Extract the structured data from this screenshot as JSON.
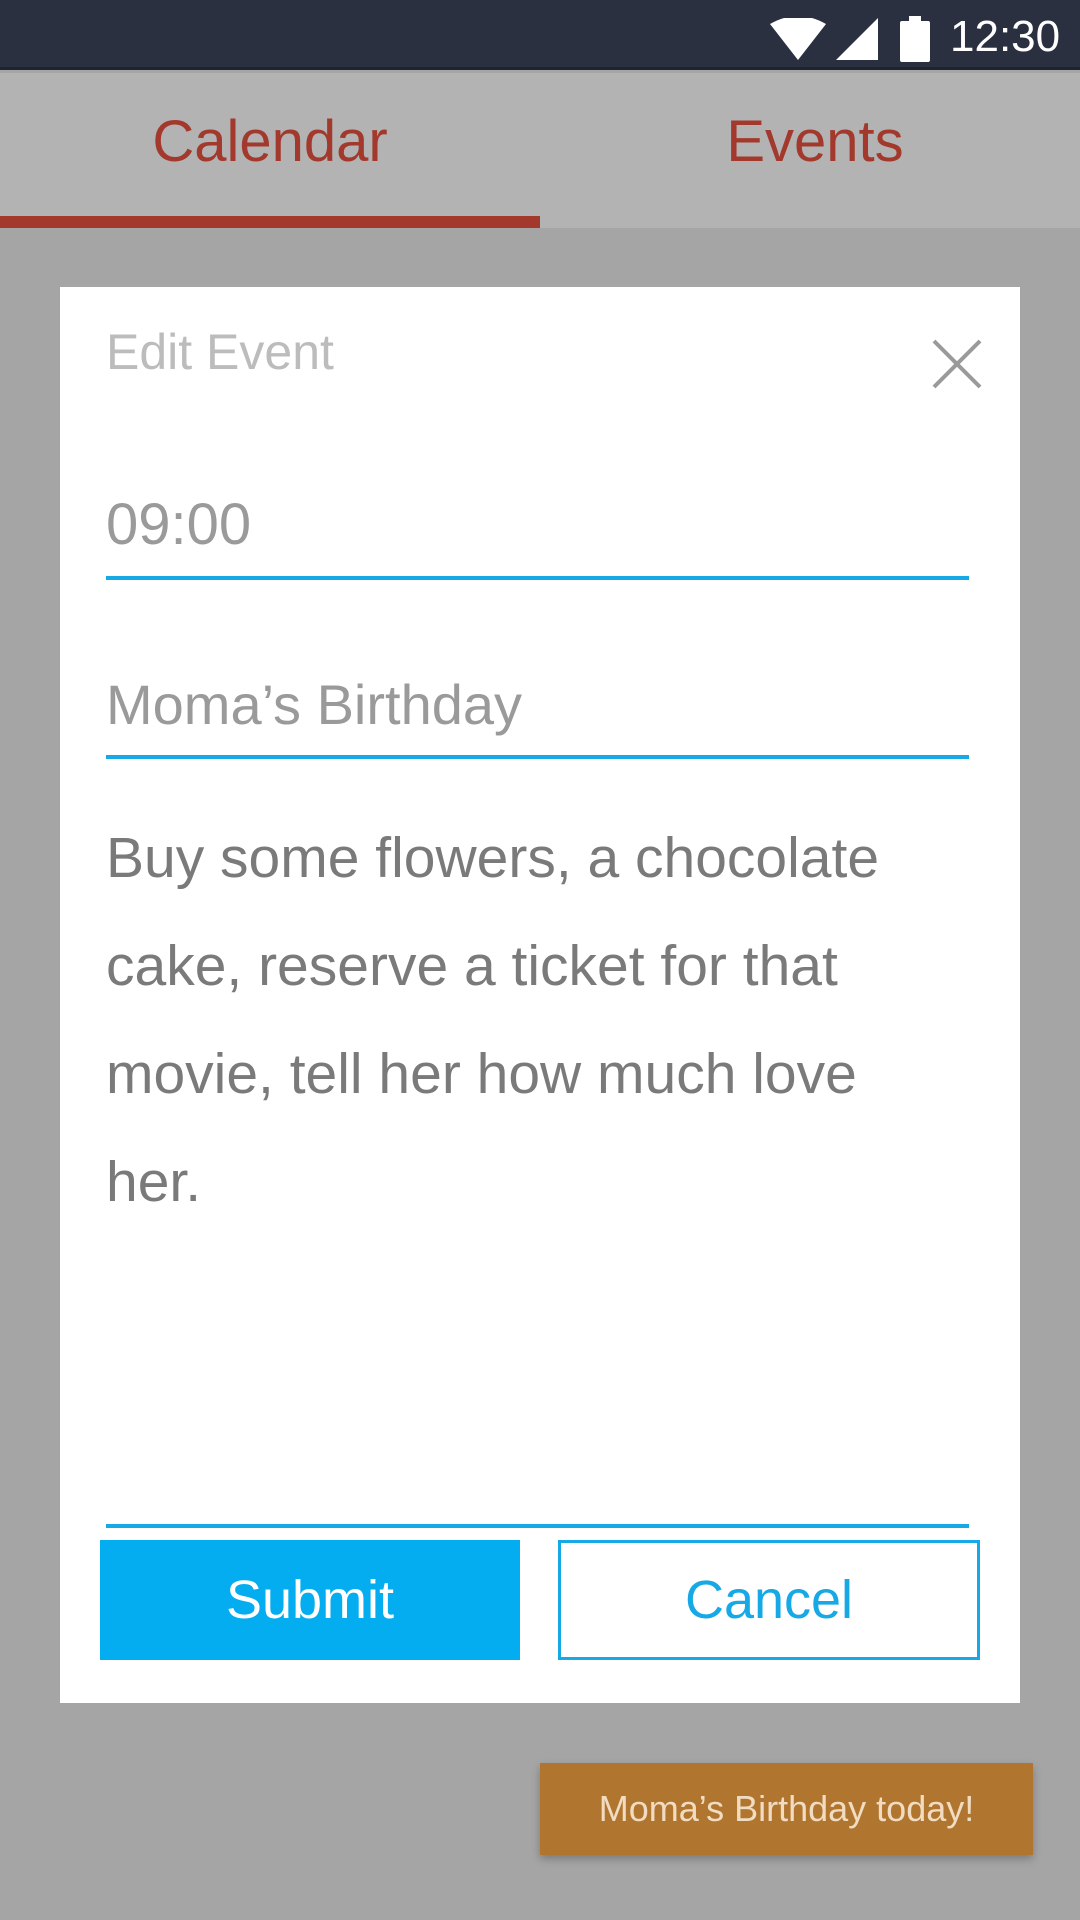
{
  "status_bar": {
    "time": "12:30",
    "icons": [
      "wifi-icon",
      "signal-icon",
      "battery-icon"
    ]
  },
  "tabs": [
    {
      "label": "Calendar",
      "selected": true
    },
    {
      "label": "Events",
      "selected": false
    }
  ],
  "dialog": {
    "title": "Edit Event",
    "close_icon": "close-icon",
    "time_value": "09:00",
    "event_title_value": "Moma’s Birthday",
    "notes_value": "Buy some flowers, a chocolate cake, reserve a ticket for that movie, tell her how much love her.",
    "submit_label": "Submit",
    "cancel_label": "Cancel"
  },
  "toast": {
    "message": "Moma’s Birthday today!"
  },
  "colors": {
    "accent_red": "#a2392c",
    "accent_blue": "#03adef",
    "toast_bg": "#b07630",
    "status_bar_bg": "#2b3041"
  }
}
